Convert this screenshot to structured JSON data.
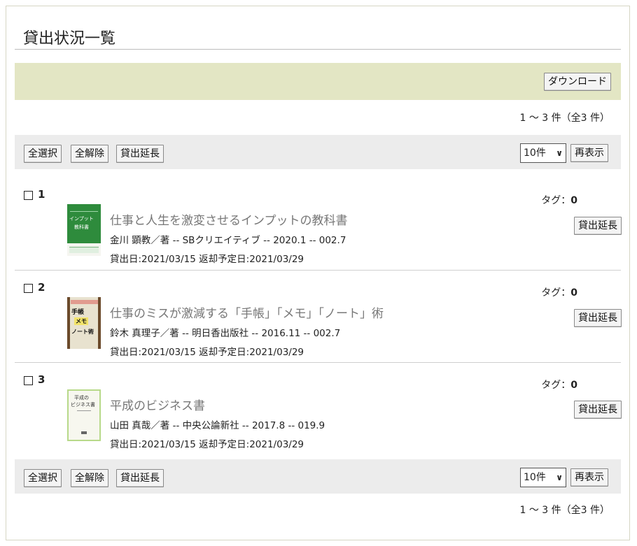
{
  "page_title": "貸出状況一覧",
  "download_label": "ダウンロード",
  "count_text": "1 ～ 3 件（全3 件）",
  "toolbar": {
    "select_all": "全選択",
    "deselect_all": "全解除",
    "extend": "貸出延長",
    "per_page": "10件",
    "refresh": "再表示"
  },
  "items": [
    {
      "number": "1",
      "title": "仕事と人生を激変させるインプットの教科書",
      "meta": "金川 顕教／著 -- SBクリエイティブ -- 2020.1 -- 002.7",
      "dates": "貸出日:2021/03/15  返却予定日:2021/03/29",
      "tag_label": "タグ：",
      "tag_count": "0",
      "extend_label": "貸出延長",
      "cover_color": "#2e8b3c",
      "cover_text_top": "インプット",
      "cover_text_mid": "教科書"
    },
    {
      "number": "2",
      "title": "仕事のミスが激減する「手帳」「メモ」「ノート」術",
      "meta": "鈴木 真理子／著 -- 明日香出版社 -- 2016.11 -- 002.7",
      "dates": "貸出日:2021/03/15  返却予定日:2021/03/29",
      "tag_label": "タグ：",
      "tag_count": "0",
      "extend_label": "貸出延長",
      "cover_color": "#e8e2cf",
      "cover_text_top": "手帳",
      "cover_text_mid": "メモ",
      "cover_text_bot": "ノート術"
    },
    {
      "number": "3",
      "title": "平成のビジネス書",
      "meta": "山田 真哉／著 -- 中央公論新社 -- 2017.8 -- 019.9",
      "dates": "貸出日:2021/03/15  返却予定日:2021/03/29",
      "tag_label": "タグ：",
      "tag_count": "0",
      "extend_label": "貸出延長",
      "cover_color": "#f7f7ef",
      "cover_text_top": "平成の",
      "cover_text_mid": "ビジネス書"
    }
  ]
}
